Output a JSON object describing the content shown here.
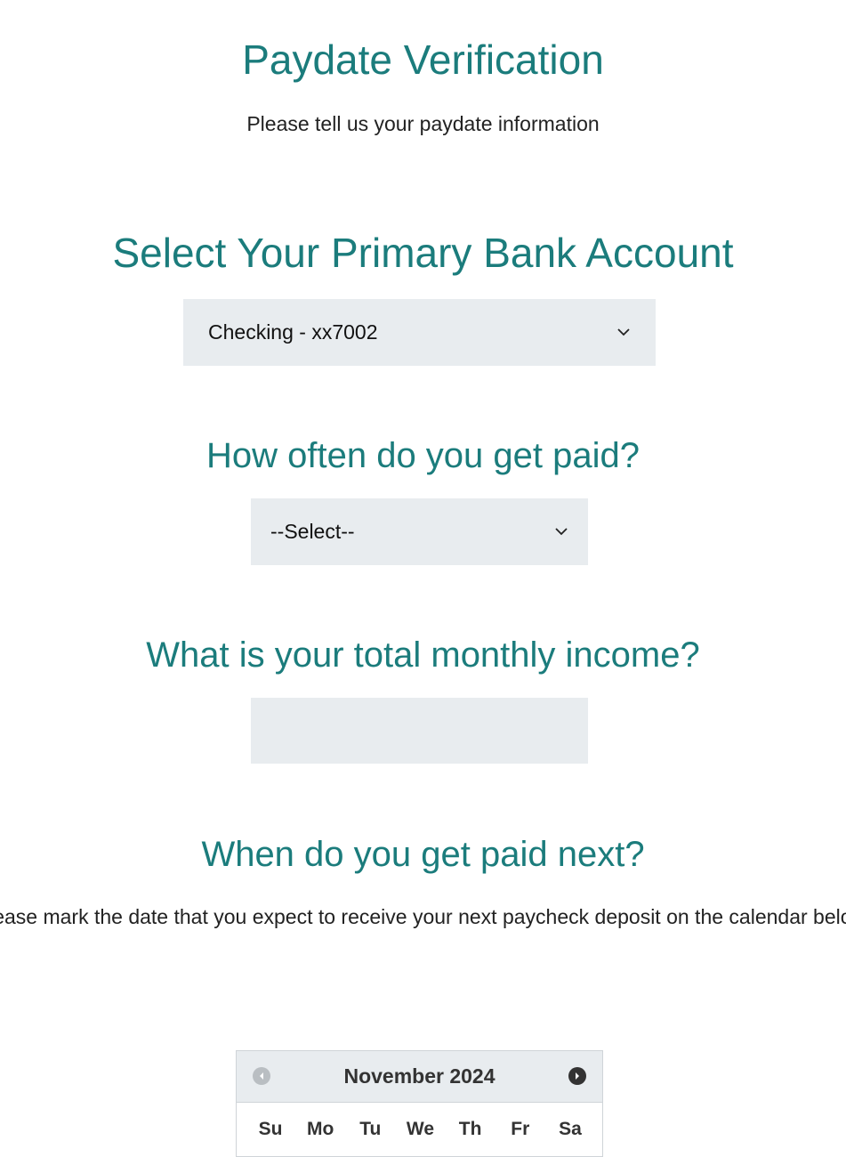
{
  "header": {
    "title": "Paydate Verification",
    "subtitle": "Please tell us your paydate information"
  },
  "bank_account": {
    "heading": "Select Your Primary Bank Account",
    "selected": "Checking - xx7002"
  },
  "pay_frequency": {
    "heading": "How often do you get paid?",
    "selected": "--Select--"
  },
  "monthly_income": {
    "heading": "What is your total monthly income?",
    "value": ""
  },
  "next_payday": {
    "heading": "When do you get paid next?",
    "instructions": "Please mark the date that you expect to receive your next paycheck deposit on the calendar below."
  },
  "calendar": {
    "month_label": "November 2024",
    "weekdays": [
      "Su",
      "Mo",
      "Tu",
      "We",
      "Th",
      "Fr",
      "Sa"
    ],
    "prev_icon": "circle-arrow-left-icon",
    "next_icon": "circle-arrow-right-icon"
  },
  "colors": {
    "accent": "#1b7c7c",
    "field_bg": "#e8ecef"
  }
}
